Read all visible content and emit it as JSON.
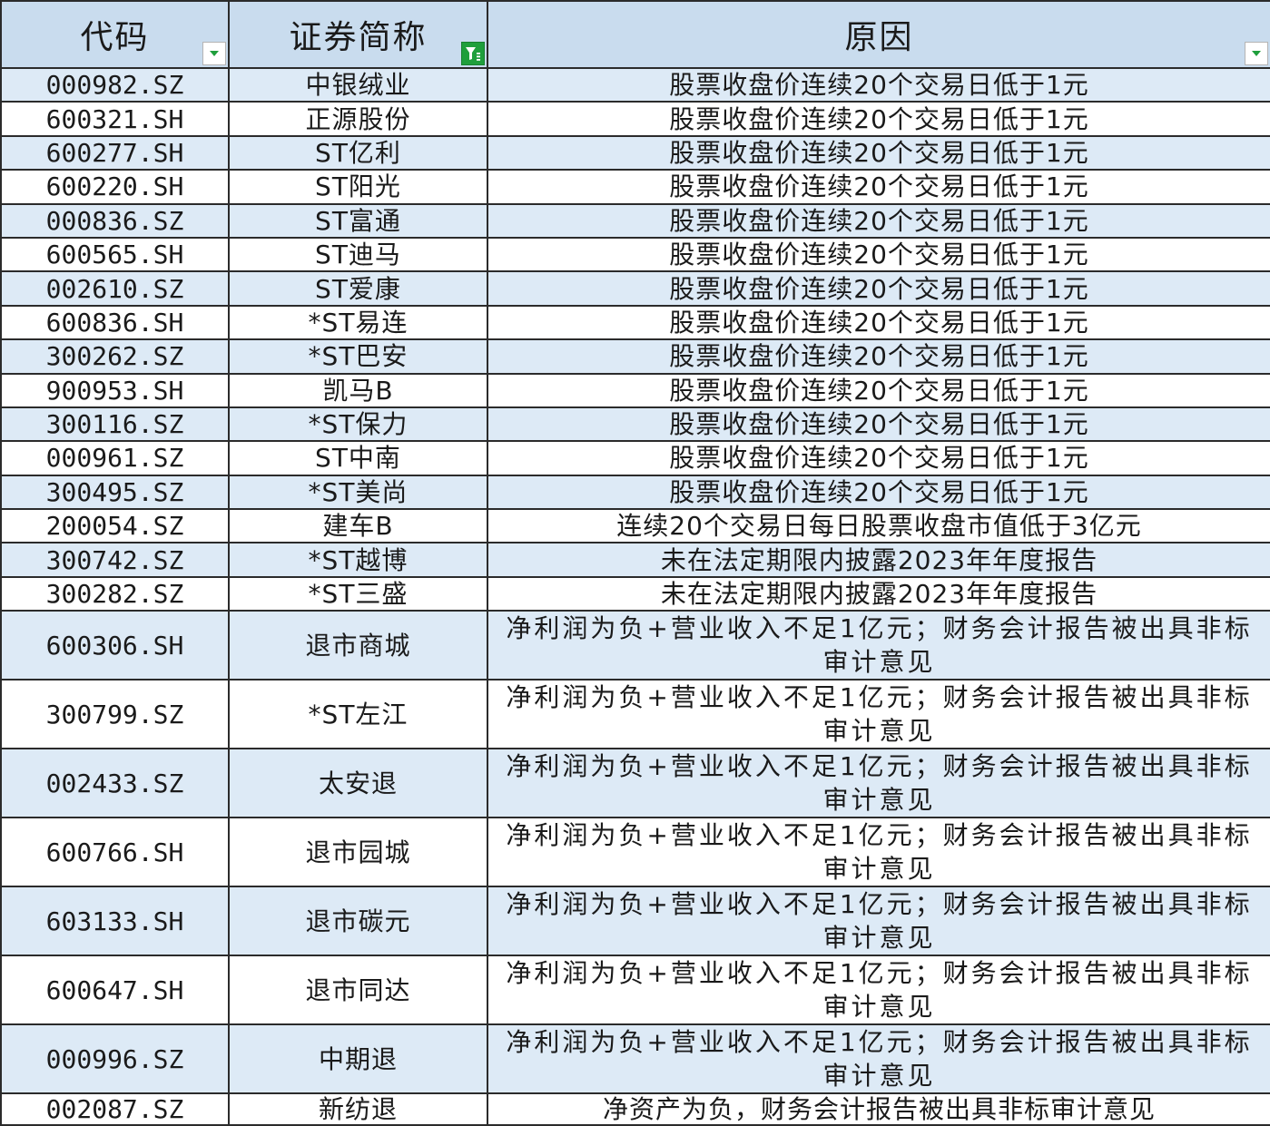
{
  "sheet": {
    "headers": {
      "code": "代码",
      "name": "证券简称",
      "reason": "原因"
    },
    "filter_states": {
      "code": "dropdown",
      "name": "filtered",
      "reason": "dropdown"
    },
    "colors": {
      "header_bg": "#c9dcee",
      "band_bg": "#ddeaf6",
      "filter_active": "#1f9f3c",
      "dropdown_arrow": "#1f9f3c"
    },
    "rows": [
      {
        "code": "000982.SZ",
        "name": "中银绒业",
        "reason": "股票收盘价连续20个交易日低于1元"
      },
      {
        "code": "600321.SH",
        "name": "正源股份",
        "reason": "股票收盘价连续20个交易日低于1元"
      },
      {
        "code": "600277.SH",
        "name": "ST亿利",
        "reason": "股票收盘价连续20个交易日低于1元"
      },
      {
        "code": "600220.SH",
        "name": "ST阳光",
        "reason": "股票收盘价连续20个交易日低于1元"
      },
      {
        "code": "000836.SZ",
        "name": "ST富通",
        "reason": "股票收盘价连续20个交易日低于1元"
      },
      {
        "code": "600565.SH",
        "name": "ST迪马",
        "reason": "股票收盘价连续20个交易日低于1元"
      },
      {
        "code": "002610.SZ",
        "name": "ST爱康",
        "reason": "股票收盘价连续20个交易日低于1元"
      },
      {
        "code": "600836.SH",
        "name": "*ST易连",
        "reason": "股票收盘价连续20个交易日低于1元"
      },
      {
        "code": "300262.SZ",
        "name": "*ST巴安",
        "reason": "股票收盘价连续20个交易日低于1元"
      },
      {
        "code": "900953.SH",
        "name": "凯马B",
        "reason": "股票收盘价连续20个交易日低于1元"
      },
      {
        "code": "300116.SZ",
        "name": "*ST保力",
        "reason": "股票收盘价连续20个交易日低于1元"
      },
      {
        "code": "000961.SZ",
        "name": "ST中南",
        "reason": "股票收盘价连续20个交易日低于1元"
      },
      {
        "code": "300495.SZ",
        "name": "*ST美尚",
        "reason": "股票收盘价连续20个交易日低于1元"
      },
      {
        "code": "200054.SZ",
        "name": "建车B",
        "reason": "连续20个交易日每日股票收盘市值低于3亿元"
      },
      {
        "code": "300742.SZ",
        "name": "*ST越博",
        "reason": "未在法定期限内披露2023年年度报告"
      },
      {
        "code": "300282.SZ",
        "name": "*ST三盛",
        "reason": "未在法定期限内披露2023年年度报告"
      },
      {
        "code": "600306.SH",
        "name": "退市商城",
        "reason": "净利润为负+营业收入不足1亿元；财务会计报告被出具非标审计意见"
      },
      {
        "code": "300799.SZ",
        "name": "*ST左江",
        "reason": "净利润为负+营业收入不足1亿元；财务会计报告被出具非标审计意见"
      },
      {
        "code": "002433.SZ",
        "name": "太安退",
        "reason": "净利润为负+营业收入不足1亿元；财务会计报告被出具非标审计意见"
      },
      {
        "code": "600766.SH",
        "name": "退市园城",
        "reason": "净利润为负+营业收入不足1亿元；财务会计报告被出具非标审计意见"
      },
      {
        "code": "603133.SH",
        "name": "退市碳元",
        "reason": "净利润为负+营业收入不足1亿元；财务会计报告被出具非标审计意见"
      },
      {
        "code": "600647.SH",
        "name": "退市同达",
        "reason": "净利润为负+营业收入不足1亿元；财务会计报告被出具非标审计意见"
      },
      {
        "code": "000996.SZ",
        "name": "中期退",
        "reason": "净利润为负+营业收入不足1亿元；财务会计报告被出具非标审计意见"
      },
      {
        "code": "002087.SZ",
        "name": "新纺退",
        "reason": "净资产为负，财务会计报告被出具非标审计意见"
      }
    ]
  }
}
